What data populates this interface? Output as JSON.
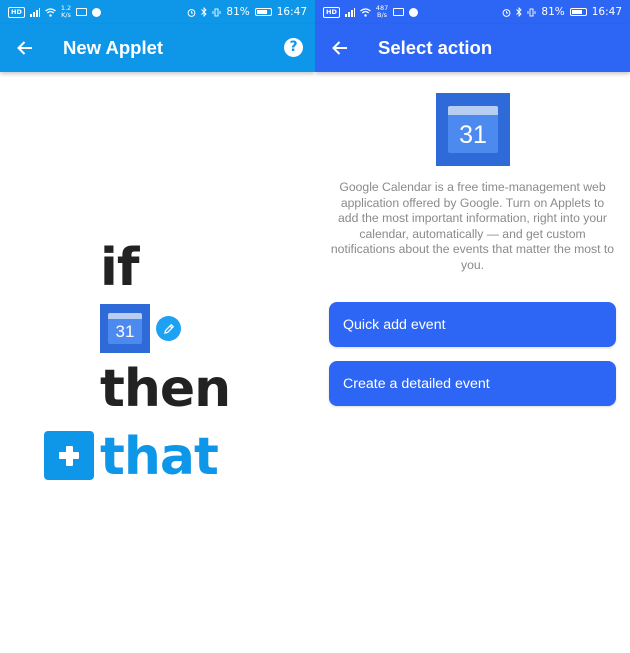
{
  "colors": {
    "left_accent": "#0e97e9",
    "right_accent": "#2d66f4",
    "text_dark": "#222222",
    "text_muted": "#8a8a8a"
  },
  "status_bar": {
    "left": {
      "network_badge": "HD",
      "speed_value": "1.2",
      "speed_unit": "K/s",
      "battery": "81%",
      "time": "16:47"
    },
    "right": {
      "network_badge": "HD",
      "speed_value": "487",
      "speed_unit": "B/s",
      "battery": "81%",
      "time": "16:47"
    }
  },
  "left_screen": {
    "title": "New Applet",
    "help_label": "?",
    "if_text": "if",
    "trigger_service_icon": "google-calendar-icon",
    "trigger_calendar_day": "31",
    "then_text": "then",
    "that_text": "that"
  },
  "right_screen": {
    "title": "Select action",
    "service_icon": "google-calendar-icon",
    "calendar_day": "31",
    "description": "Google Calendar is a free time-management web application offered by Google. Turn on Applets to add the most important information, right into your calendar, automatically — and get custom notifications about the events that matter the most to you.",
    "actions": [
      {
        "label": "Quick add event"
      },
      {
        "label": "Create a detailed event"
      }
    ]
  }
}
